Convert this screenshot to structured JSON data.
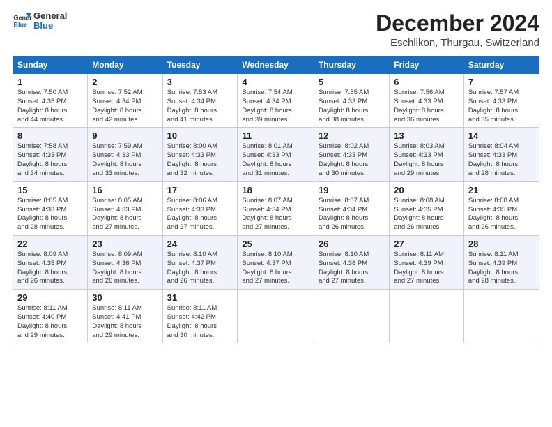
{
  "header": {
    "logo_line1": "General",
    "logo_line2": "Blue",
    "month_title": "December 2024",
    "location": "Eschlikon, Thurgau, Switzerland"
  },
  "days_of_week": [
    "Sunday",
    "Monday",
    "Tuesday",
    "Wednesday",
    "Thursday",
    "Friday",
    "Saturday"
  ],
  "weeks": [
    [
      {
        "day": "1",
        "sunrise": "7:50 AM",
        "sunset": "4:35 PM",
        "daylight": "8 hours and 44 minutes."
      },
      {
        "day": "2",
        "sunrise": "7:52 AM",
        "sunset": "4:34 PM",
        "daylight": "8 hours and 42 minutes."
      },
      {
        "day": "3",
        "sunrise": "7:53 AM",
        "sunset": "4:34 PM",
        "daylight": "8 hours and 41 minutes."
      },
      {
        "day": "4",
        "sunrise": "7:54 AM",
        "sunset": "4:34 PM",
        "daylight": "8 hours and 39 minutes."
      },
      {
        "day": "5",
        "sunrise": "7:55 AM",
        "sunset": "4:33 PM",
        "daylight": "8 hours and 38 minutes."
      },
      {
        "day": "6",
        "sunrise": "7:56 AM",
        "sunset": "4:33 PM",
        "daylight": "8 hours and 36 minutes."
      },
      {
        "day": "7",
        "sunrise": "7:57 AM",
        "sunset": "4:33 PM",
        "daylight": "8 hours and 35 minutes."
      }
    ],
    [
      {
        "day": "8",
        "sunrise": "7:58 AM",
        "sunset": "4:33 PM",
        "daylight": "8 hours and 34 minutes."
      },
      {
        "day": "9",
        "sunrise": "7:59 AM",
        "sunset": "4:33 PM",
        "daylight": "8 hours and 33 minutes."
      },
      {
        "day": "10",
        "sunrise": "8:00 AM",
        "sunset": "4:33 PM",
        "daylight": "8 hours and 32 minutes."
      },
      {
        "day": "11",
        "sunrise": "8:01 AM",
        "sunset": "4:33 PM",
        "daylight": "8 hours and 31 minutes."
      },
      {
        "day": "12",
        "sunrise": "8:02 AM",
        "sunset": "4:33 PM",
        "daylight": "8 hours and 30 minutes."
      },
      {
        "day": "13",
        "sunrise": "8:03 AM",
        "sunset": "4:33 PM",
        "daylight": "8 hours and 29 minutes."
      },
      {
        "day": "14",
        "sunrise": "8:04 AM",
        "sunset": "4:33 PM",
        "daylight": "8 hours and 28 minutes."
      }
    ],
    [
      {
        "day": "15",
        "sunrise": "8:05 AM",
        "sunset": "4:33 PM",
        "daylight": "8 hours and 28 minutes."
      },
      {
        "day": "16",
        "sunrise": "8:05 AM",
        "sunset": "4:33 PM",
        "daylight": "8 hours and 27 minutes."
      },
      {
        "day": "17",
        "sunrise": "8:06 AM",
        "sunset": "4:33 PM",
        "daylight": "8 hours and 27 minutes."
      },
      {
        "day": "18",
        "sunrise": "8:07 AM",
        "sunset": "4:34 PM",
        "daylight": "8 hours and 27 minutes."
      },
      {
        "day": "19",
        "sunrise": "8:07 AM",
        "sunset": "4:34 PM",
        "daylight": "8 hours and 26 minutes."
      },
      {
        "day": "20",
        "sunrise": "8:08 AM",
        "sunset": "4:35 PM",
        "daylight": "8 hours and 26 minutes."
      },
      {
        "day": "21",
        "sunrise": "8:08 AM",
        "sunset": "4:35 PM",
        "daylight": "8 hours and 26 minutes."
      }
    ],
    [
      {
        "day": "22",
        "sunrise": "8:09 AM",
        "sunset": "4:35 PM",
        "daylight": "8 hours and 26 minutes."
      },
      {
        "day": "23",
        "sunrise": "8:09 AM",
        "sunset": "4:36 PM",
        "daylight": "8 hours and 26 minutes."
      },
      {
        "day": "24",
        "sunrise": "8:10 AM",
        "sunset": "4:37 PM",
        "daylight": "8 hours and 26 minutes."
      },
      {
        "day": "25",
        "sunrise": "8:10 AM",
        "sunset": "4:37 PM",
        "daylight": "8 hours and 27 minutes."
      },
      {
        "day": "26",
        "sunrise": "8:10 AM",
        "sunset": "4:38 PM",
        "daylight": "8 hours and 27 minutes."
      },
      {
        "day": "27",
        "sunrise": "8:11 AM",
        "sunset": "4:39 PM",
        "daylight": "8 hours and 27 minutes."
      },
      {
        "day": "28",
        "sunrise": "8:11 AM",
        "sunset": "4:39 PM",
        "daylight": "8 hours and 28 minutes."
      }
    ],
    [
      {
        "day": "29",
        "sunrise": "8:11 AM",
        "sunset": "4:40 PM",
        "daylight": "8 hours and 29 minutes."
      },
      {
        "day": "30",
        "sunrise": "8:11 AM",
        "sunset": "4:41 PM",
        "daylight": "8 hours and 29 minutes."
      },
      {
        "day": "31",
        "sunrise": "8:11 AM",
        "sunset": "4:42 PM",
        "daylight": "8 hours and 30 minutes."
      },
      null,
      null,
      null,
      null
    ]
  ],
  "labels": {
    "sunrise": "Sunrise:",
    "sunset": "Sunset:",
    "daylight": "Daylight:"
  }
}
